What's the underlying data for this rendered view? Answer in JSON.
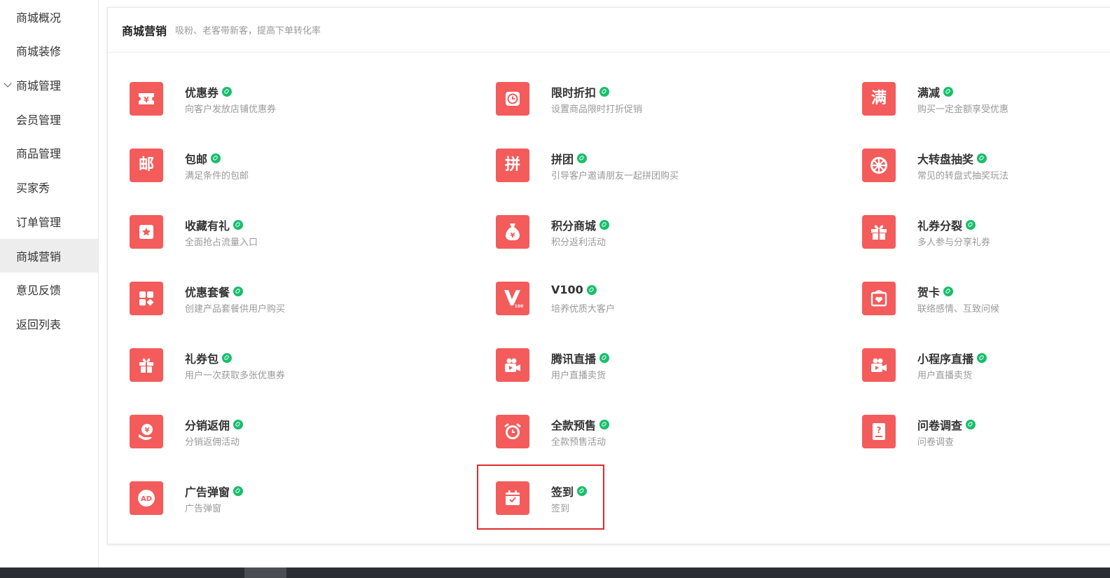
{
  "sidebar": {
    "items": [
      {
        "label": "商城概况",
        "active": false,
        "expanded": false
      },
      {
        "label": "商城装修",
        "active": false,
        "expanded": false
      },
      {
        "label": "商城管理",
        "active": false,
        "expanded": true
      },
      {
        "label": "会员管理",
        "active": false,
        "expanded": false
      },
      {
        "label": "商品管理",
        "active": false,
        "expanded": false
      },
      {
        "label": "买家秀",
        "active": false,
        "expanded": false
      },
      {
        "label": "订单管理",
        "active": false,
        "expanded": false
      },
      {
        "label": "商城营销",
        "active": true,
        "expanded": false
      },
      {
        "label": "意见反馈",
        "active": false,
        "expanded": false
      },
      {
        "label": "返回列表",
        "active": false,
        "expanded": false
      }
    ]
  },
  "header": {
    "title": "商城营销",
    "subtitle": "吸粉、老客带新客，提高下单转化率"
  },
  "tiles": [
    {
      "name": "优惠券",
      "desc": "向客户发放店铺优惠券",
      "icon": "ticket-icon"
    },
    {
      "name": "限时折扣",
      "desc": "设置商品限时打折促销",
      "icon": "clock-icon"
    },
    {
      "name": "满减",
      "desc": "购买一定金额享受优惠",
      "icon": "text-glyph-icon",
      "glyph": "满"
    },
    {
      "name": "包邮",
      "desc": "满足条件的包邮",
      "icon": "text-glyph-icon",
      "glyph": "邮"
    },
    {
      "name": "拼团",
      "desc": "引导客户邀请朋友一起拼团购买",
      "icon": "text-glyph-icon",
      "glyph": "拼"
    },
    {
      "name": "大转盘抽奖",
      "desc": "常见的转盘式抽奖玩法",
      "icon": "wheel-icon"
    },
    {
      "name": "收藏有礼",
      "desc": "全面抢占流量入口",
      "icon": "star-icon"
    },
    {
      "name": "积分商城",
      "desc": "积分返利活动",
      "icon": "money-bag-icon"
    },
    {
      "name": "礼券分裂",
      "desc": "多人参与分享礼券",
      "icon": "gift-icon"
    },
    {
      "name": "优惠套餐",
      "desc": "创建产品套餐供用户购买",
      "icon": "grid-icon"
    },
    {
      "name": "V100",
      "desc": "培养优质大客户",
      "icon": "v100-icon"
    },
    {
      "name": "贺卡",
      "desc": "联络感情、互致问候",
      "icon": "card-heart-icon"
    },
    {
      "name": "礼券包",
      "desc": "用户一次获取多张优惠券",
      "icon": "gift-box-icon"
    },
    {
      "name": "腾讯直播",
      "desc": "用户直播卖货",
      "icon": "video-camera-icon"
    },
    {
      "name": "小程序直播",
      "desc": "用户直播卖货",
      "icon": "video-camera-icon"
    },
    {
      "name": "分销返佣",
      "desc": "分销返佣活动",
      "icon": "coin-hand-icon"
    },
    {
      "name": "全款预售",
      "desc": "全款预售活动",
      "icon": "alarm-clock-icon"
    },
    {
      "name": "问卷调查",
      "desc": "问卷调查",
      "icon": "questionnaire-icon"
    },
    {
      "name": "广告弹窗",
      "desc": "广告弹窗",
      "icon": "ad-icon"
    },
    {
      "name": "签到",
      "desc": "签到",
      "icon": "calendar-check-icon"
    }
  ],
  "colors": {
    "icon_bg": "#f45b5b",
    "link_badge": "#19be6b",
    "highlight_border": "#e02a2a",
    "sidebar_active_bg": "#ededee"
  }
}
